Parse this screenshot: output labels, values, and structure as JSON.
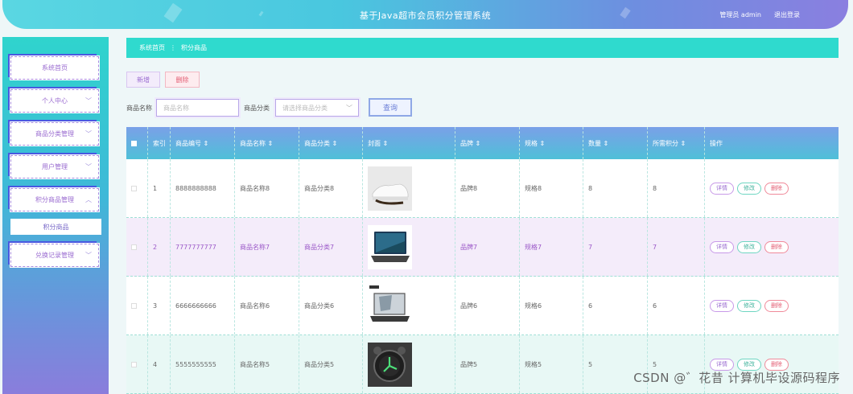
{
  "header": {
    "title": "基于Java超市会员积分管理系统",
    "user": "管理员 admin",
    "logout": "退出登录"
  },
  "sidebar": {
    "items": [
      {
        "label": "系统首页",
        "chevron": ""
      },
      {
        "label": "个人中心",
        "chevron": "﹀"
      },
      {
        "label": "商品分类管理",
        "chevron": "﹀"
      },
      {
        "label": "用户管理",
        "chevron": "﹀"
      },
      {
        "label": "积分商品管理",
        "chevron": "︿"
      },
      {
        "label": "兑换记录管理",
        "chevron": "﹀"
      }
    ],
    "sub_item": "积分商品"
  },
  "breadcrumb": {
    "home": "系统首页",
    "sep": "⋮",
    "current": "积分商品"
  },
  "toolbar": {
    "add": "新增",
    "delete": "删除"
  },
  "search": {
    "name_label": "商品名称",
    "name_placeholder": "商品名称",
    "category_label": "商品分类",
    "category_placeholder": "请选择商品分类",
    "button": "查询",
    "caret": "﹀"
  },
  "table": {
    "headers": [
      "索引",
      "商品编号 ⇕",
      "商品名称 ⇕",
      "商品分类 ⇕",
      "封面 ⇕",
      "品牌 ⇕",
      "规格 ⇕",
      "数量 ⇕",
      "所需积分 ⇕",
      "操作"
    ],
    "rows": [
      {
        "index": "1",
        "code": "8888888888",
        "name": "商品名称8",
        "category": "商品分类8",
        "brand": "品牌8",
        "spec": "规格8",
        "qty": "8",
        "points": "8"
      },
      {
        "index": "2",
        "code": "7777777777",
        "name": "商品名称7",
        "category": "商品分类7",
        "brand": "品牌7",
        "spec": "规格7",
        "qty": "7",
        "points": "7"
      },
      {
        "index": "3",
        "code": "6666666666",
        "name": "商品名称6",
        "category": "商品分类6",
        "brand": "品牌6",
        "spec": "规格6",
        "qty": "6",
        "points": "6"
      },
      {
        "index": "4",
        "code": "5555555555",
        "name": "商品名称5",
        "category": "商品分类5",
        "brand": "品牌5",
        "spec": "规格5",
        "qty": "5",
        "points": "5"
      }
    ],
    "ops": {
      "detail": "详情",
      "edit": "修改",
      "delete": "删除"
    }
  },
  "watermark": "CSDN @゛花昔 计算机毕设源码程序",
  "colors": {
    "accent": "#2fdace",
    "purple": "#9a6bd0",
    "danger": "#e35d73"
  }
}
